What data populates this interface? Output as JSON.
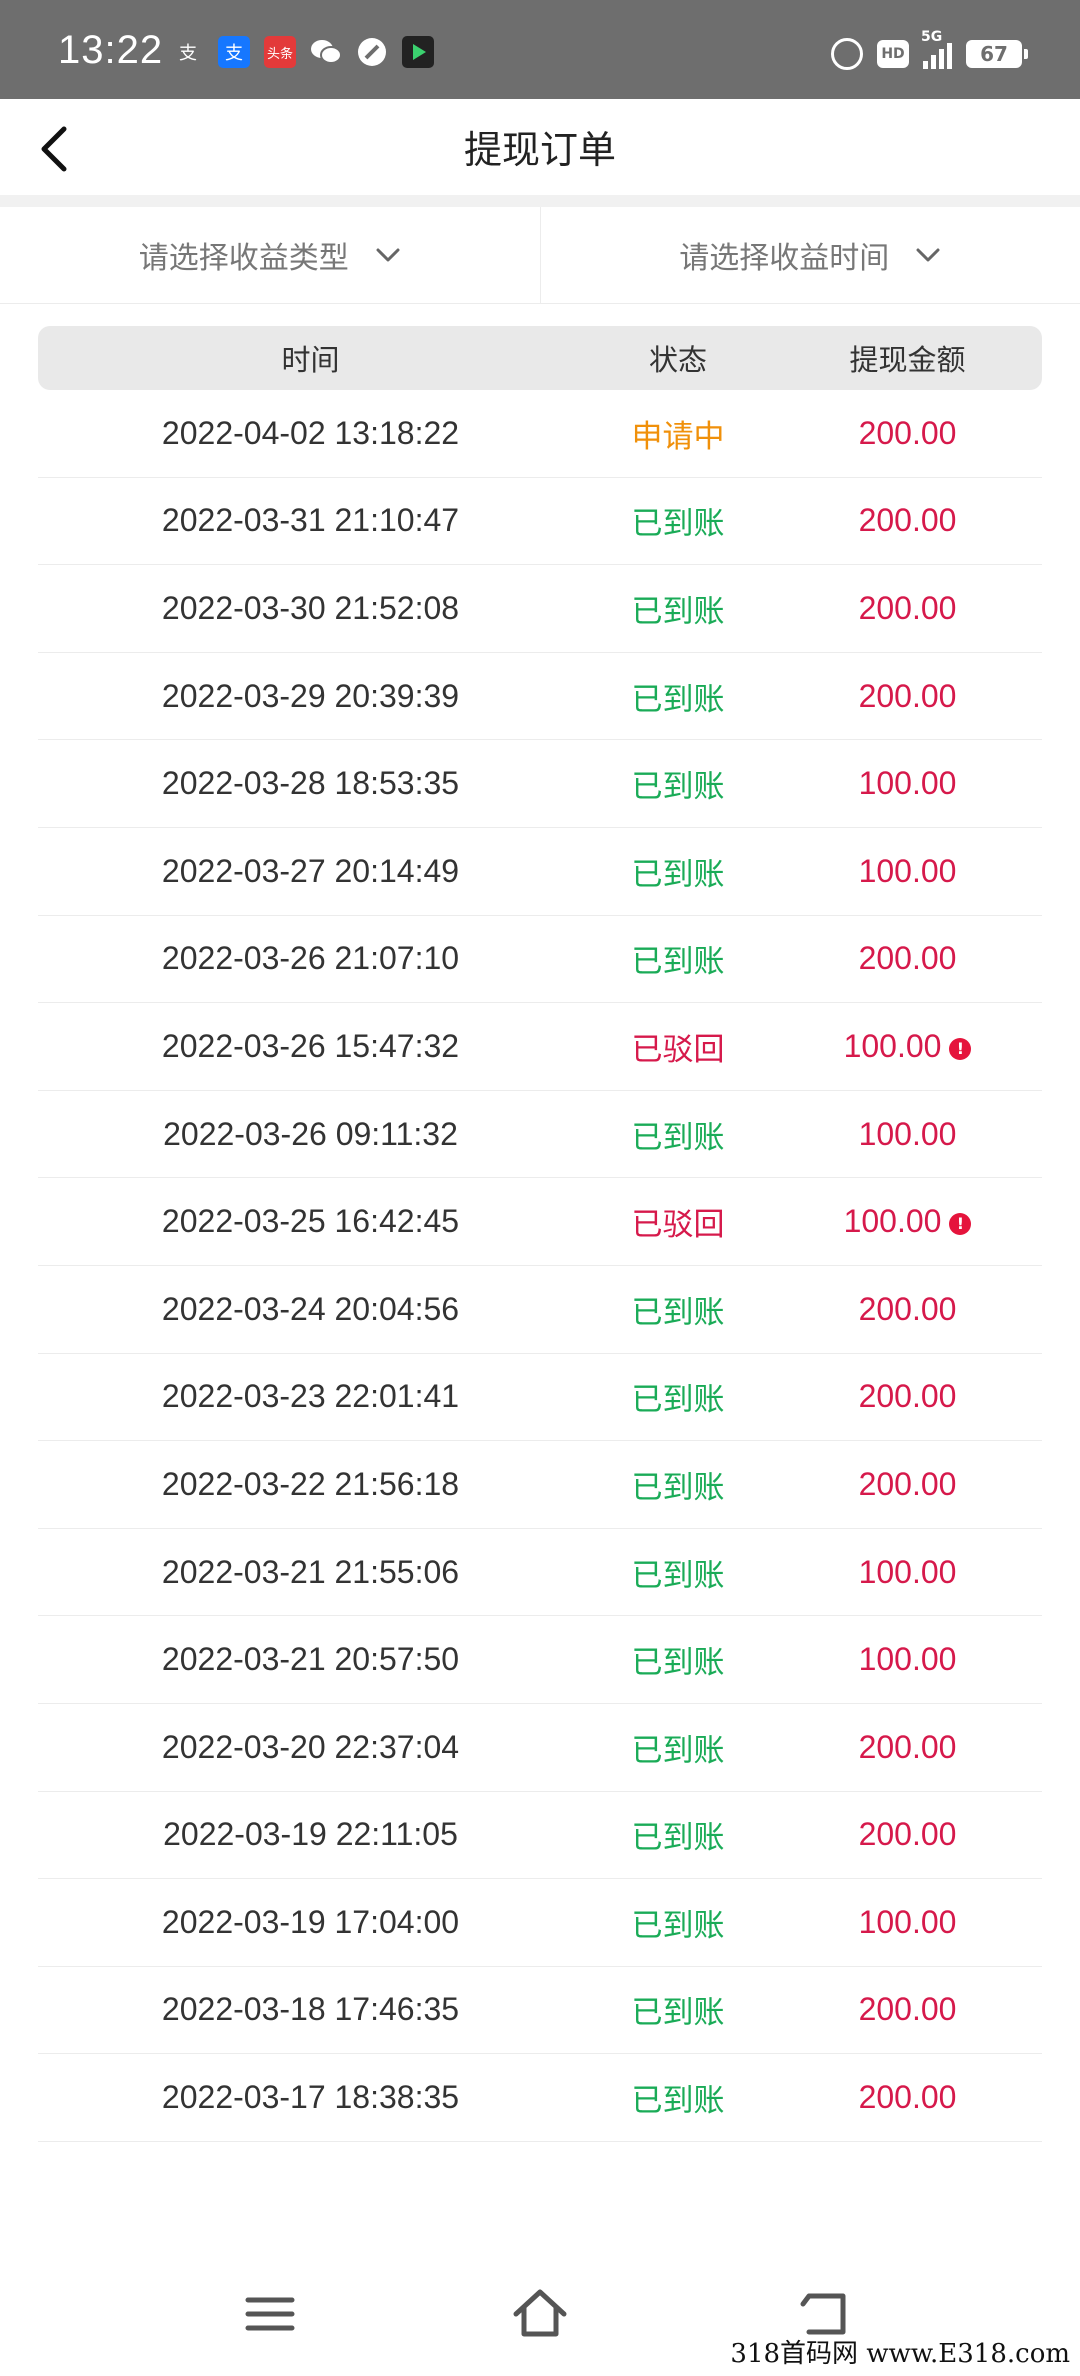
{
  "status_bar": {
    "time": "13:22",
    "signal_label": "5G",
    "hd_label": "HD",
    "battery": "67",
    "apps": [
      "alipay-icon",
      "alipay-news-icon",
      "toutiao-icon",
      "wechat-icon",
      "compass-icon",
      "video-app-icon"
    ]
  },
  "header": {
    "title": "提现订单"
  },
  "filters": {
    "type_label": "请选择收益类型",
    "time_label": "请选择收益时间"
  },
  "table": {
    "columns": [
      "时间",
      "状态",
      "提现金额"
    ],
    "rows": [
      {
        "time": "2022-04-02 13:18:22",
        "status": "申请中",
        "amount": "200.00"
      },
      {
        "time": "2022-03-31 21:10:47",
        "status": "已到账",
        "amount": "200.00"
      },
      {
        "time": "2022-03-30 21:52:08",
        "status": "已到账",
        "amount": "200.00"
      },
      {
        "time": "2022-03-29 20:39:39",
        "status": "已到账",
        "amount": "200.00"
      },
      {
        "time": "2022-03-28 18:53:35",
        "status": "已到账",
        "amount": "100.00"
      },
      {
        "time": "2022-03-27 20:14:49",
        "status": "已到账",
        "amount": "100.00"
      },
      {
        "time": "2022-03-26 21:07:10",
        "status": "已到账",
        "amount": "200.00"
      },
      {
        "time": "2022-03-26 15:47:32",
        "status": "已驳回",
        "amount": "100.00",
        "warn": "!"
      },
      {
        "time": "2022-03-26 09:11:32",
        "status": "已到账",
        "amount": "100.00"
      },
      {
        "time": "2022-03-25 16:42:45",
        "status": "已驳回",
        "amount": "100.00",
        "warn": "!"
      },
      {
        "time": "2022-03-24 20:04:56",
        "status": "已到账",
        "amount": "200.00"
      },
      {
        "time": "2022-03-23 22:01:41",
        "status": "已到账",
        "amount": "200.00"
      },
      {
        "time": "2022-03-22 21:56:18",
        "status": "已到账",
        "amount": "200.00"
      },
      {
        "time": "2022-03-21 21:55:06",
        "status": "已到账",
        "amount": "100.00"
      },
      {
        "time": "2022-03-21 20:57:50",
        "status": "已到账",
        "amount": "100.00"
      },
      {
        "time": "2022-03-20 22:37:04",
        "status": "已到账",
        "amount": "200.00"
      },
      {
        "time": "2022-03-19 22:11:05",
        "status": "已到账",
        "amount": "200.00"
      },
      {
        "time": "2022-03-19 17:04:00",
        "status": "已到账",
        "amount": "100.00"
      },
      {
        "time": "2022-03-18 17:46:35",
        "status": "已到账",
        "amount": "200.00"
      },
      {
        "time": "2022-03-17 18:38:35",
        "status": "已到账",
        "amount": "200.00"
      }
    ]
  },
  "status_colors": {
    "申请中": "#f0900a",
    "已到账": "#1aab57",
    "已驳回": "#d6194b"
  },
  "amount_color": "#d6194b",
  "watermark": "318首码网 www.E318.com"
}
